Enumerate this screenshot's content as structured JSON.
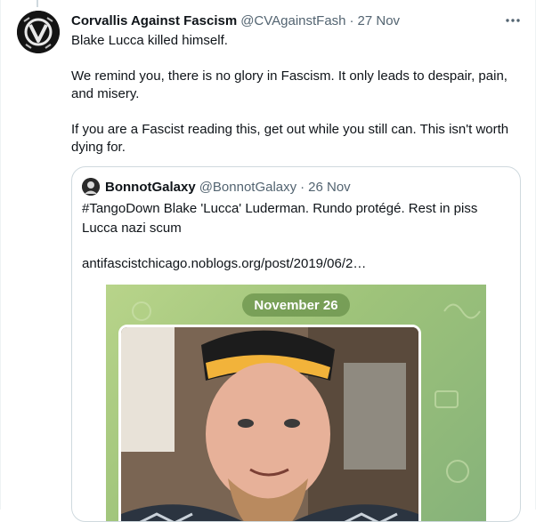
{
  "tweet": {
    "author_name": "Corvallis Against Fascism",
    "author_handle": "@CVAgainstFash",
    "separator": "·",
    "date": "27 Nov",
    "paragraphs": [
      "Blake Lucca killed himself.",
      "We remind you, there is no glory in Fascism. It only leads to despair, pain, and misery.",
      "If you are a Fascist reading this, get out while you still can. This isn't worth dying for."
    ],
    "more_icon": "ellipsis-icon"
  },
  "quote": {
    "author_name": "BonnotGalaxy",
    "author_handle": "@BonnotGalaxy",
    "separator": "·",
    "date": "26 Nov",
    "text": "#TangoDown Blake 'Lucca' Luderman. Rundo protégé. Rest in piss Lucca nazi scum",
    "link": "antifascistchicago.noblogs.org/post/2019/06/2…",
    "media": {
      "date_label": "November 26"
    }
  },
  "colors": {
    "text": "#0f1419",
    "secondary": "#536471",
    "border": "#cfd9de",
    "media_green": "#9ec37a"
  }
}
